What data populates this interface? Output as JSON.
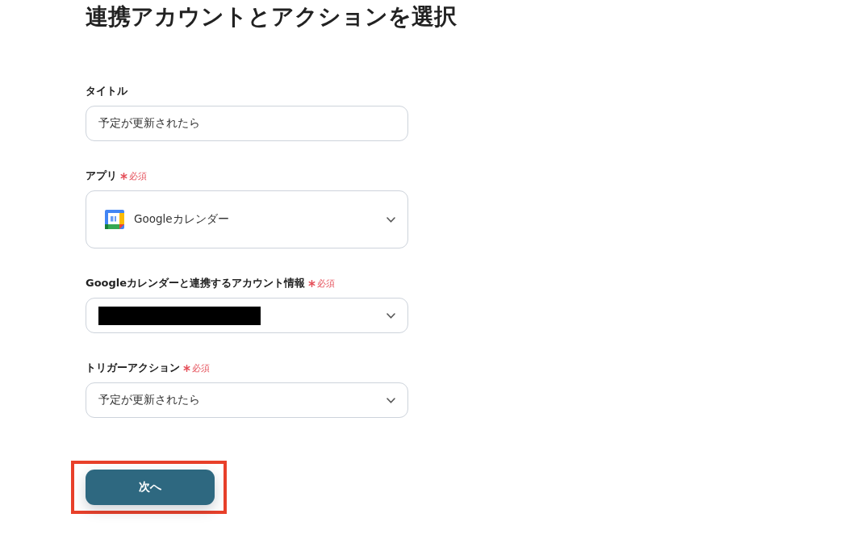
{
  "page": {
    "title": "連携アカウントとアクションを選択"
  },
  "fields": [
    {
      "kind": "input",
      "label": "タイトル",
      "required": false,
      "value": "予定が更新されたら"
    },
    {
      "kind": "app_select",
      "label": "アプリ",
      "required": true,
      "required_text": "必須",
      "value": "Googleカレンダー"
    },
    {
      "kind": "redacted_select",
      "label": "Googleカレンダーと連携するアカウント情報",
      "required": true,
      "required_text": "必須"
    },
    {
      "kind": "select",
      "label": "トリガーアクション",
      "required": true,
      "required_text": "必須",
      "value": "予定が更新されたら"
    }
  ],
  "next_button": {
    "label": "次へ",
    "highlighted": true
  }
}
